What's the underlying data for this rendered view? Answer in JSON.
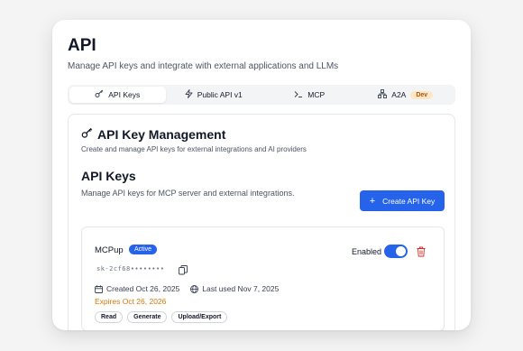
{
  "page": {
    "title": "API",
    "subtitle": "Manage API keys and integrate with external applications and LLMs"
  },
  "tabs": [
    {
      "label": "API Keys",
      "icon": "key-icon",
      "active": true
    },
    {
      "label": "Public API v1",
      "icon": "lightning-icon",
      "active": false
    },
    {
      "label": "MCP",
      "icon": "terminal-icon",
      "active": false
    },
    {
      "label": "A2A",
      "icon": "network-icon",
      "active": false,
      "badge": "Dev"
    }
  ],
  "management": {
    "title": "API Key Management",
    "subtitle": "Create and manage API keys for external integrations and AI providers"
  },
  "keys_section": {
    "title": "API Keys",
    "subtitle": "Manage API keys for MCP server and external integrations.",
    "create_label": "Create API Key"
  },
  "key": {
    "name": "MCPup",
    "status": "Active",
    "masked": "sk-2cf68••••••••",
    "created": "Created Oct 26, 2025",
    "last_used": "Last used Nov 7, 2025",
    "expires": "Expires Oct 26, 2026",
    "enabled_label": "Enabled",
    "enabled": true,
    "permissions": [
      "Read",
      "Generate",
      "Upload/Export"
    ]
  },
  "colors": {
    "accent": "#2563eb",
    "warning": "#d97706",
    "danger": "#dc2626",
    "dev_badge_bg": "#fde7c8"
  }
}
